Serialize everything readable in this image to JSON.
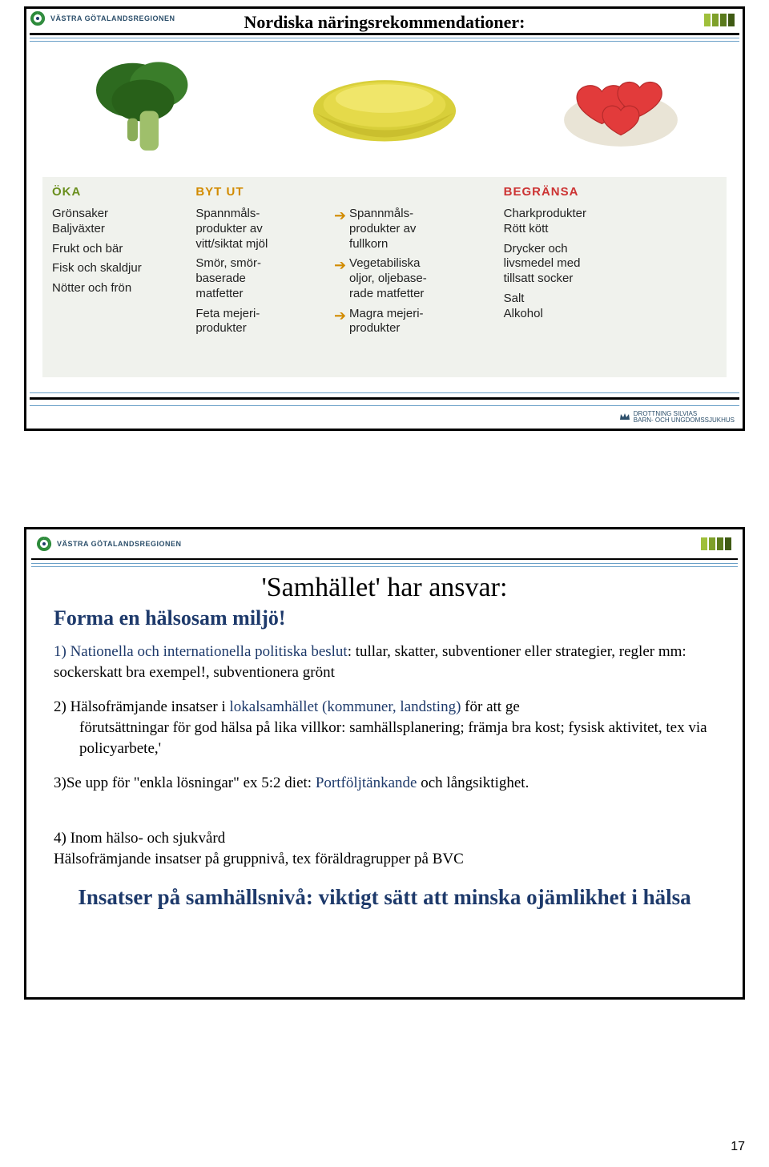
{
  "slide1": {
    "brand": "VÄSTRA GÖTALANDSREGIONEN",
    "title": "Nordiska näringsrekommendationer:",
    "food_alt": {
      "broccoli": "broccoli",
      "oil": "olive oil bowl",
      "candy": "red candy hearts"
    },
    "oka": {
      "heading": "ÖKA",
      "items": [
        "Grönsaker\nBaljväxter",
        "Frukt och bär",
        "Fisk och skaldjur",
        "Nötter och frön"
      ]
    },
    "bytut": {
      "heading": "BYT UT",
      "rows": [
        {
          "from": "Spannmåls-\nprodukter av\nvitt/siktat mjöl",
          "to": "Spannmåls-\nprodukter av\nfullkorn"
        },
        {
          "from": "Smör, smör-\nbaserade\nmatfetter",
          "to": "Vegetabiliska\noljor, oljebase-\nrade matfetter"
        },
        {
          "from": "Feta mejeri-\nprodukter",
          "to": "Magra mejeri-\nprodukter"
        }
      ]
    },
    "begransa": {
      "heading": "BEGRÄNSA",
      "items": [
        "Charkprodukter\nRött kött",
        "Drycker och\nlivsmedel med\ntillsatt socker",
        "Salt\nAlkohol"
      ]
    },
    "hospital": "DROTTNING SILVIAS\nBARN- OCH UNGDOMSSJUKHUS"
  },
  "slide2": {
    "brand": "VÄSTRA GÖTALANDSREGIONEN",
    "title": "'Samhället' har ansvar:",
    "subtitle": "Forma en hälsosam miljö!",
    "p1_lead": "1) Nationella och internationella politiska beslut",
    "p1_rest": ": tullar, skatter, subventioner eller strategier, regler mm: sockerskatt  bra exempel!, subventionera grönt",
    "p2_lead": "2) Hälsofrämjande insatser i ",
    "p2_highlight": "lokalsamhället (kommuner, landsting)",
    "p2_rest1": "  för att ge",
    "p2_indent": "förutsättningar för god hälsa på lika villkor: samhällsplanering; främja bra kost; fysisk aktivitet, tex via policyarbete,'",
    "p3_lead": "3)Se upp för \"enkla lösningar\" ex 5:2 diet: ",
    "p3_highlight": "Portföljtänkande",
    "p3_rest": " och långsiktighet.",
    "p4": "4) Inom hälso- och sjukvård\n Hälsofrämjande insatser på gruppnivå, tex föräldragrupper på BVC",
    "closing": "Insatser på samhällsnivå: viktigt sätt att minska ojämlikhet i hälsa"
  },
  "pageNumber": "17"
}
